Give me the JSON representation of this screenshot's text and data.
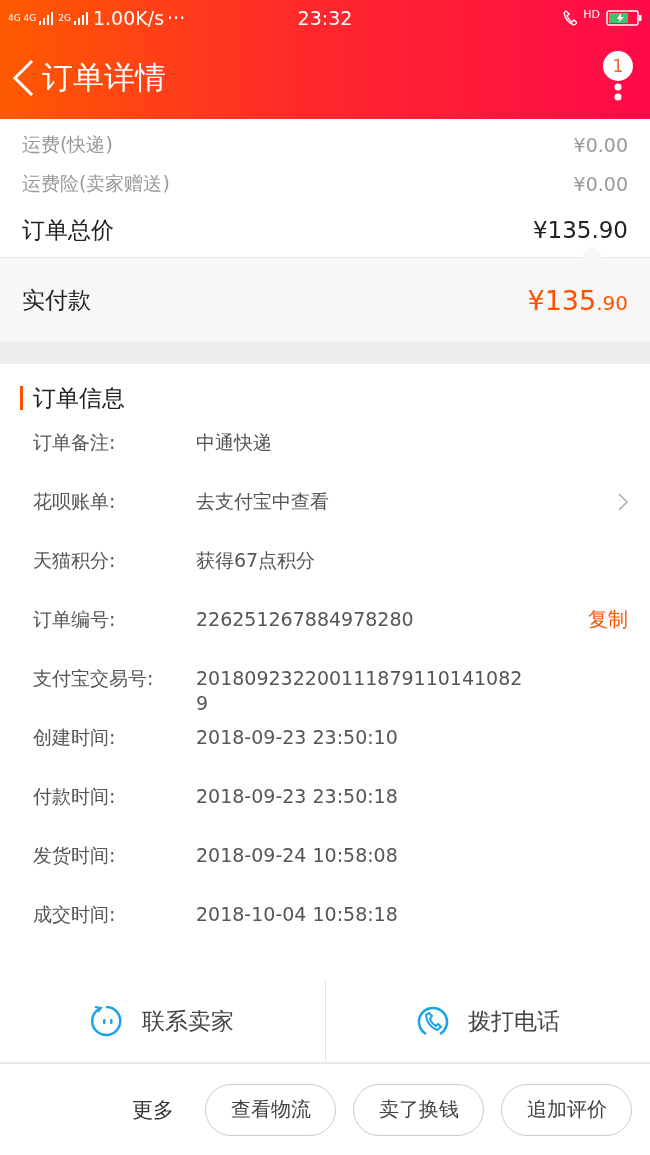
{
  "status_bar": {
    "network": "4G 4G",
    "network2": "2G",
    "speed": "1.00K/s",
    "more": "···",
    "time": "23:32",
    "hd": "HD"
  },
  "header": {
    "title": "订单详情",
    "badge": "1"
  },
  "fees": [
    {
      "label": "运费(快递)",
      "value": "¥0.00"
    },
    {
      "label": "运费险(卖家赠送)",
      "value": "¥0.00"
    }
  ],
  "total": {
    "label": "订单总价",
    "value": "¥135.90"
  },
  "paid": {
    "label": "实付款",
    "main": "¥135",
    "fraction": ".90"
  },
  "info": {
    "title": "订单信息",
    "rows": [
      {
        "label": "订单备注:",
        "value": "中通快递"
      },
      {
        "label": "花呗账单:",
        "value": "去支付宝中查看",
        "kind": "link"
      },
      {
        "label": "天猫积分:",
        "value": "获得67点积分"
      },
      {
        "label": "订单编号:",
        "value": "226251267884978280",
        "action": "复制",
        "kind": "copy"
      },
      {
        "label": "支付宝交易号:",
        "value": "2018092322001118791101410829"
      },
      {
        "label": "创建时间:",
        "value": "2018-09-23 23:50:10"
      },
      {
        "label": "付款时间:",
        "value": "2018-09-23 23:50:18"
      },
      {
        "label": "发货时间:",
        "value": "2018-09-24 10:58:08"
      },
      {
        "label": "成交时间:",
        "value": "2018-10-04 10:58:18"
      }
    ]
  },
  "contact": [
    {
      "label": "联系卖家",
      "kind": "chat"
    },
    {
      "label": "拨打电话",
      "kind": "phone"
    }
  ],
  "bottom": {
    "more": "更多",
    "buttons": [
      "查看物流",
      "卖了换钱",
      "追加评价"
    ]
  }
}
